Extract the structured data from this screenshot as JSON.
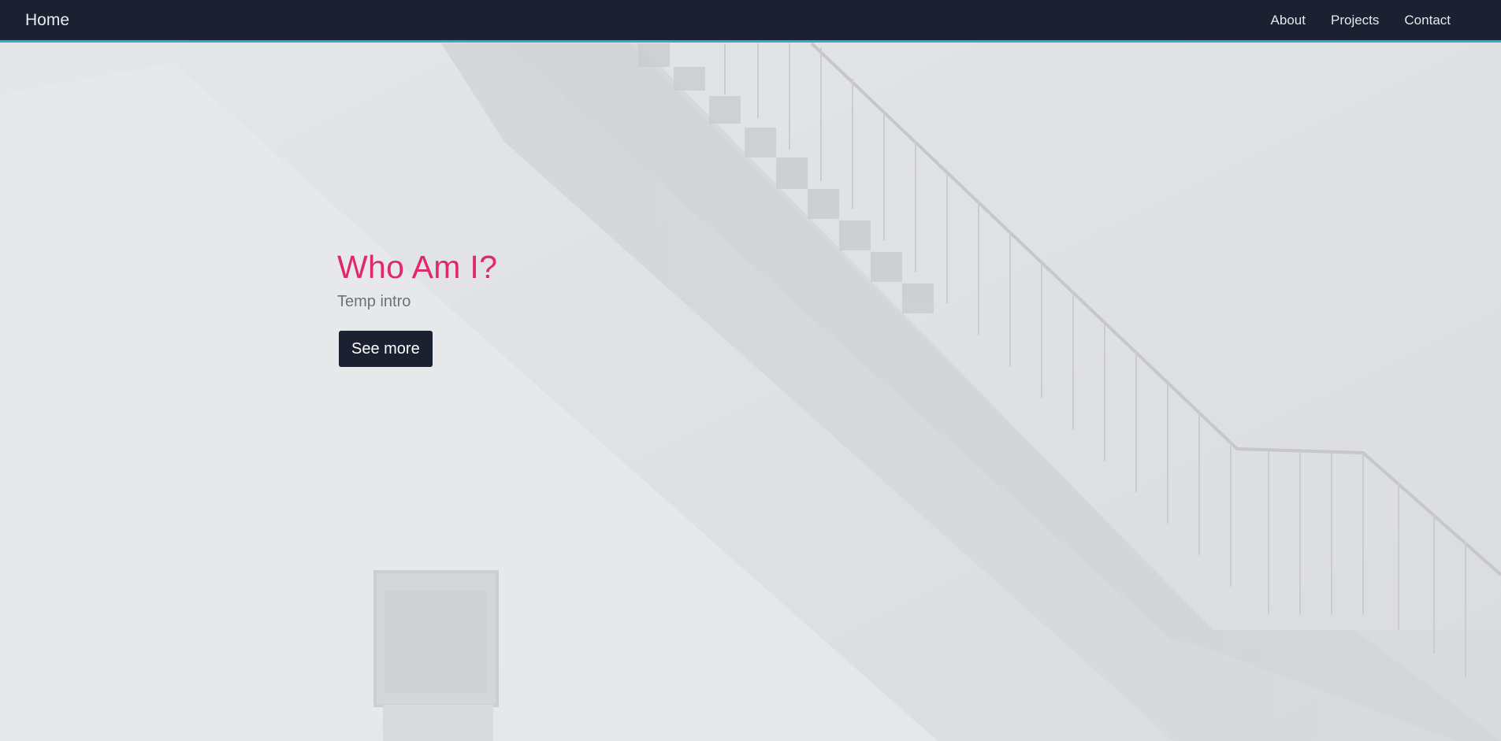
{
  "navbar": {
    "brand": "Home",
    "links": [
      "About",
      "Projects",
      "Contact"
    ]
  },
  "hero": {
    "title": "Who Am I?",
    "subtitle": "Temp intro",
    "button_label": "See more",
    "background": "staircase-wall-photo"
  },
  "colors": {
    "navbar_bg": "#1b2130",
    "navbar_accent": "#23b3c4",
    "title": "#e0286f",
    "button_bg": "#1b2130"
  }
}
